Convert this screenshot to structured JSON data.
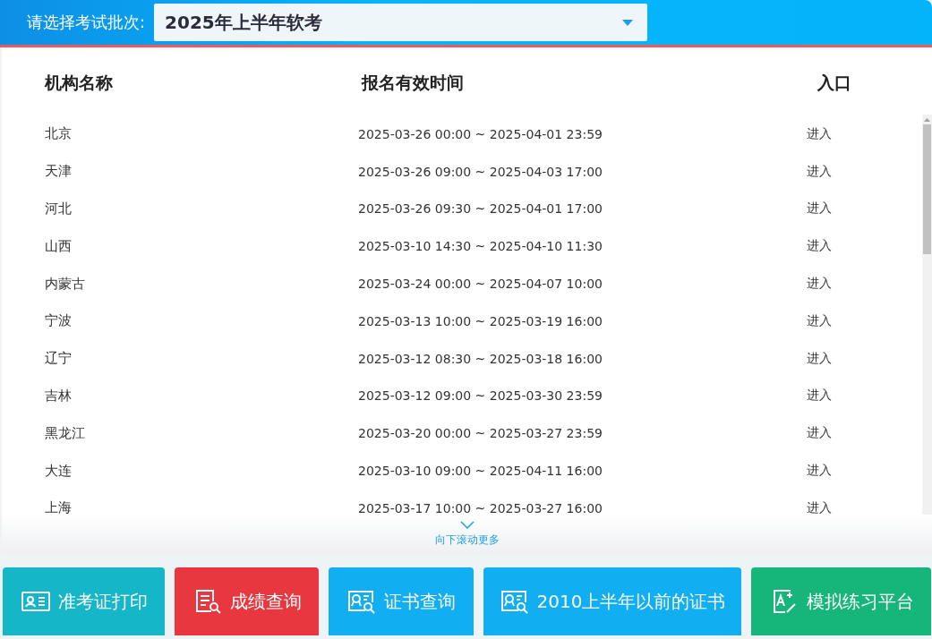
{
  "header": {
    "label": "请选择考试批次:",
    "select_value": "2025年上半年软考"
  },
  "table": {
    "columns": [
      "机构名称",
      "报名有效时间",
      "入口"
    ],
    "rows": [
      {
        "name": "北京",
        "time": "2025-03-26 00:00 ~ 2025-04-01 23:59",
        "entry": "进入"
      },
      {
        "name": "天津",
        "time": "2025-03-26 09:00 ~ 2025-04-03 17:00",
        "entry": "进入"
      },
      {
        "name": "河北",
        "time": "2025-03-26 09:30 ~ 2025-04-01 17:00",
        "entry": "进入"
      },
      {
        "name": "山西",
        "time": "2025-03-10 14:30 ~ 2025-04-10 11:30",
        "entry": "进入"
      },
      {
        "name": "内蒙古",
        "time": "2025-03-24 00:00 ~ 2025-04-07 10:00",
        "entry": "进入"
      },
      {
        "name": "宁波",
        "time": "2025-03-13 10:00 ~ 2025-03-19 16:00",
        "entry": "进入"
      },
      {
        "name": "辽宁",
        "time": "2025-03-12 08:30 ~ 2025-03-18 16:00",
        "entry": "进入"
      },
      {
        "name": "吉林",
        "time": "2025-03-12 09:00 ~ 2025-03-30 23:59",
        "entry": "进入"
      },
      {
        "name": "黑龙江",
        "time": "2025-03-20 00:00 ~ 2025-03-27 23:59",
        "entry": "进入"
      },
      {
        "name": "大连",
        "time": "2025-03-10 09:00 ~ 2025-04-11 16:00",
        "entry": "进入"
      },
      {
        "name": "上海",
        "time": "2025-03-17 10:00 ~ 2025-03-27 16:00",
        "entry": "进入"
      }
    ]
  },
  "scroll_hint": "向下滚动更多",
  "buttons": [
    {
      "label": "准考证打印",
      "kind": "id-card",
      "color": "#14b6c8"
    },
    {
      "label": "成绩查询",
      "kind": "report",
      "color": "#e8373f"
    },
    {
      "label": "证书查询",
      "kind": "certificate",
      "color": "#11aef2"
    },
    {
      "label": "2010上半年以前的证书",
      "kind": "certificate",
      "color": "#11aef2"
    },
    {
      "label": "模拟练习平台",
      "kind": "practice",
      "color": "#16b67b"
    }
  ]
}
